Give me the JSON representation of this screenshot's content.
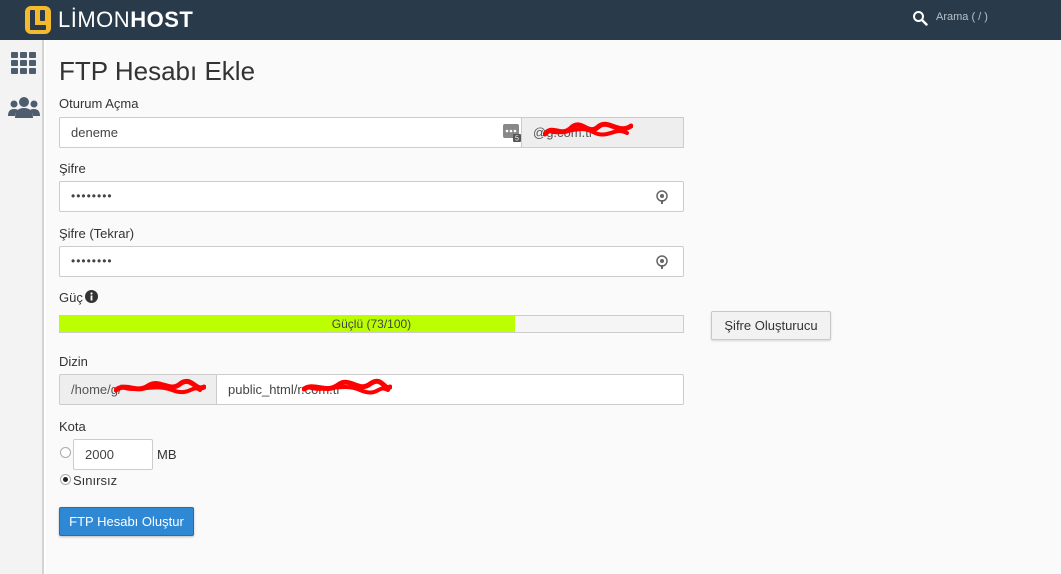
{
  "header": {
    "logo_light": "LİMON",
    "logo_bold": "HOST",
    "search_placeholder": "Arama ( / )"
  },
  "page": {
    "title": "FTP Hesabı Ekle"
  },
  "form": {
    "login_label": "Oturum Açma",
    "login_value": "deneme",
    "domain_suffix": "@g.com.tr",
    "password_label": "Şifre",
    "password_value": "••••••••",
    "password_confirm_label": "Şifre (Tekrar)",
    "password_confirm_value": "••••••••",
    "strength_label": "Güç",
    "strength_text": "Güçlü (73/100)",
    "strength_score": 73,
    "generator_button": "Şifre Oluşturucu",
    "directory_label": "Dizin",
    "directory_prefix": "/home/g/",
    "directory_value": "public_html/r.com.tr",
    "quota_label": "Kota",
    "quota_value": "2000",
    "quota_unit": "MB",
    "unlimited_label": "Sınırsız",
    "quota_mode": "unlimited",
    "submit_button": "FTP Hesabı Oluştur"
  },
  "colors": {
    "topbar": "#293a4a",
    "strength_fill": "#bbff00",
    "primary_button": "#2e88d4"
  }
}
